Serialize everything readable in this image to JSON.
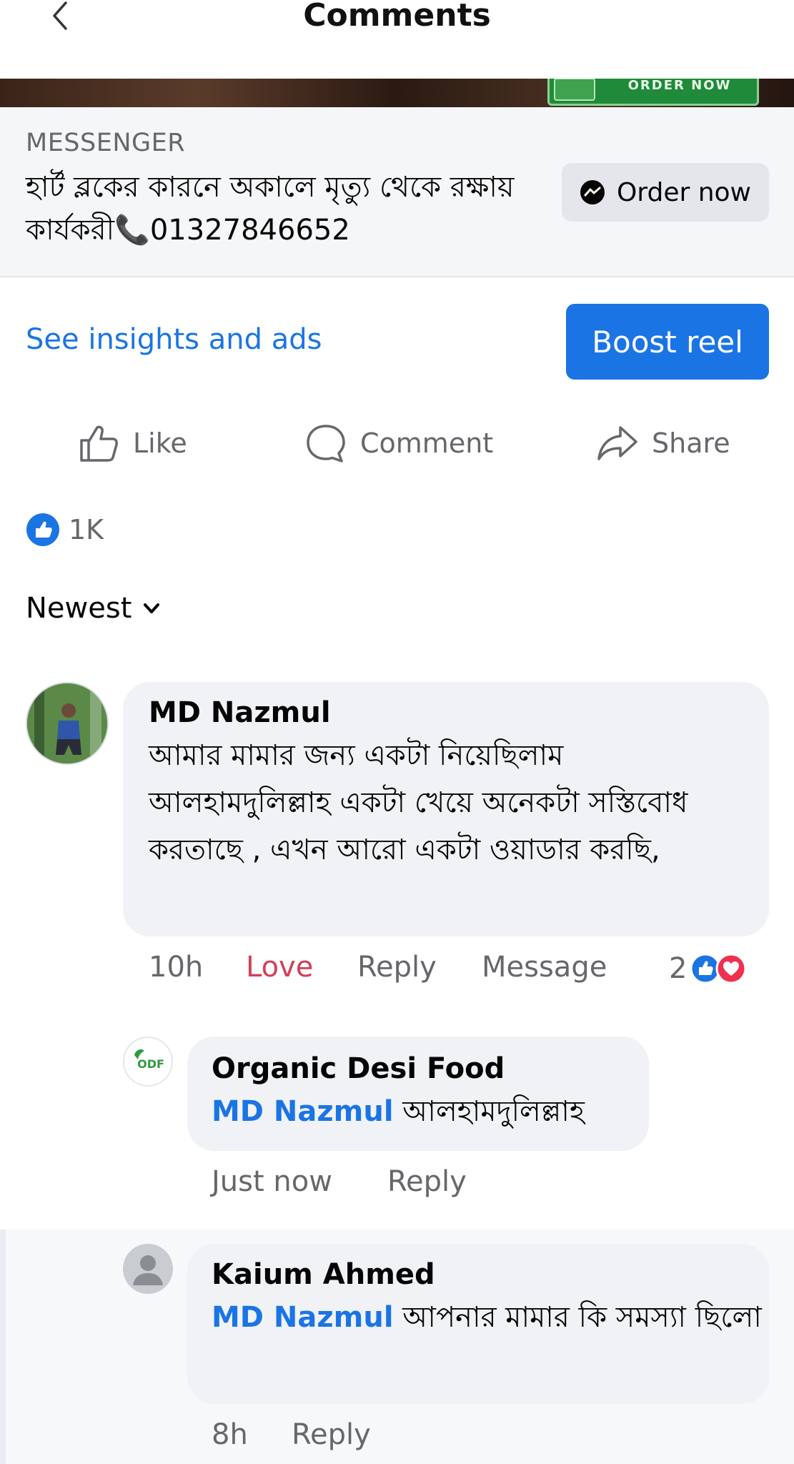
{
  "header": {
    "title": "Comments",
    "back_icon": "chevron-left-icon"
  },
  "media": {
    "cta_label": "ORDER NOW"
  },
  "ad": {
    "source": "MESSENGER",
    "text": "হার্ট ব্লকের কারনে অকালে মৃত্যু থেকে রক্ষায় কার্যকরী📞01327846652",
    "order_button_label": "Order now",
    "order_button_icon": "messenger-icon"
  },
  "insights": {
    "link_label": "See insights and ads",
    "boost_label": "Boost reel"
  },
  "actions": {
    "like_label": "Like",
    "comment_label": "Comment",
    "share_label": "Share"
  },
  "reactions": {
    "count": "1K",
    "icon": "like-reaction-icon"
  },
  "sort": {
    "label": "Newest",
    "icon": "chevron-down-icon"
  },
  "comments": [
    {
      "author": "MD Nazmul",
      "text": "আমার মামার জন্য  একটা নিয়েছিলাম আলহামদুলিল্লাহ একটা খেয়ে অনেকটা সস্তিবোধ করতাছে , এখন আরো একটা ওয়াডার করছি,",
      "time": "10h",
      "reaction_given": "Love",
      "reply_label": "Reply",
      "message_label": "Message",
      "reaction_count": "2"
    },
    {
      "author": "Organic Desi Food",
      "mention": "MD Nazmul",
      "text": "আলহামদুলিল্লাহ",
      "time": "Just now",
      "reply_label": "Reply",
      "avatar_text": "ODF"
    },
    {
      "author": "Kaium Ahmed",
      "mention": "MD Nazmul",
      "text": "আপনার মামার কি সমস্যা ছিলো",
      "time": "8h",
      "reply_label": "Reply"
    }
  ],
  "colors": {
    "accent": "#1b74e4",
    "love": "#d33f58",
    "muted": "#65676b",
    "bubble": "#f0f2f5"
  }
}
